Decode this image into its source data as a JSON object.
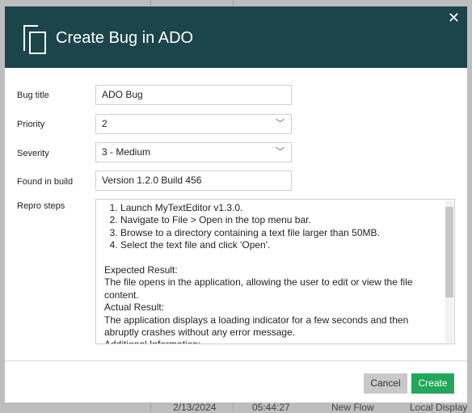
{
  "background": {
    "cells": [
      "2/13/2024",
      "05:44:27",
      "New Flow",
      "Local Display"
    ]
  },
  "dialog": {
    "title": "Create Bug in ADO",
    "close_icon": "close-icon",
    "fields": {
      "bug_title": {
        "label": "Bug title",
        "value": "ADO Bug"
      },
      "priority": {
        "label": "Priority",
        "value": "2"
      },
      "severity": {
        "label": "Severity",
        "value": "3 - Medium"
      },
      "found_in_build": {
        "label": "Found in build",
        "value": "Version 1.2.0 Build 456"
      },
      "repro_steps": {
        "label": "Repro steps",
        "value": "  1. Launch MyTextEditor v1.3.0.\n  2. Navigate to File > Open in the top menu bar.\n  3. Browse to a directory containing a text file larger than 50MB.\n  4. Select the text file and click 'Open'.\n\nExpected Result:\nThe file opens in the application, allowing the user to edit or view the file content.\nActual Result:\nThe application displays a loading indicator for a few seconds and then abruptly crashes without any error message.\nAdditional Information:..."
      }
    },
    "buttons": {
      "cancel": "Cancel",
      "create": "Create"
    },
    "colors": {
      "header": "#1b454b",
      "create": "#22a75a",
      "cancel": "#c9c9c9"
    }
  }
}
